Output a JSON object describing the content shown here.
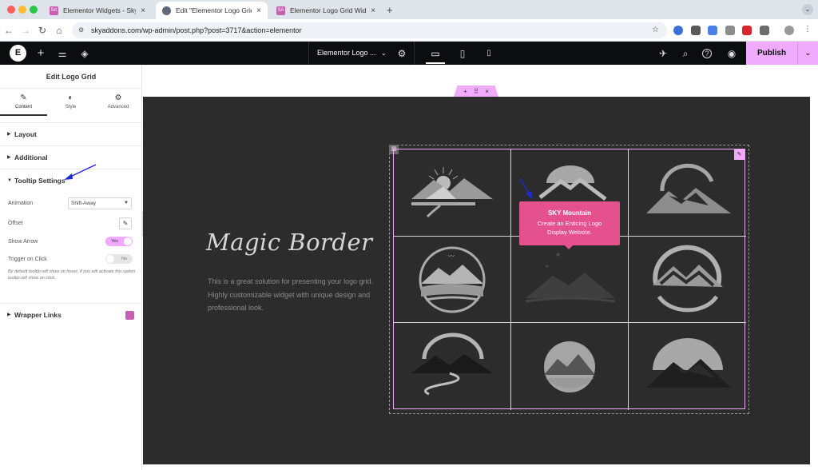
{
  "browser": {
    "tabs": [
      {
        "title": "Elementor Widgets - Sky Add",
        "active": false
      },
      {
        "title": "Edit \"Elementor Logo Grid W",
        "active": true
      },
      {
        "title": "Elementor Logo Grid Widget",
        "active": false
      }
    ],
    "new_tab": "+",
    "url": "skyaddons.com/wp-admin/post.php?post=3717&action=elementor"
  },
  "editor": {
    "logo": "E",
    "document_title": "Elementor Logo ...",
    "publish_label": "Publish"
  },
  "panel": {
    "title": "Edit Logo Grid",
    "tabs": [
      {
        "label": "Content",
        "icon": "pencil-icon"
      },
      {
        "label": "Style",
        "icon": "half-circle-icon"
      },
      {
        "label": "Advanced",
        "icon": "gear-icon"
      }
    ],
    "sections": {
      "layout": "Layout",
      "additional": "Additional",
      "tooltip": "Tooltip Settings",
      "wrapper": "Wrapper Links"
    },
    "controls": {
      "animation_label": "Animation",
      "animation_value": "Shift-Away",
      "offset_label": "Offset",
      "show_arrow_label": "Show Arrow",
      "show_arrow_state": "Yes",
      "trigger_label": "Trigger on Click",
      "trigger_state": "No",
      "hint": "By default tooltip will show on hover, if you will activate this option tooltip will show on click."
    }
  },
  "canvas": {
    "heading": "Magic Border",
    "description": "This is a great solution for presenting your logo grid. Highly customizable widget with unique design and professional look.",
    "tooltip": {
      "title": "SKY Mountain",
      "body": "Create an Enticing Logo Display Website."
    }
  },
  "colors": {
    "accent": "#f0abfc",
    "tooltip": "#e5508f",
    "canvas_bg": "#2d2c2c",
    "annotation_arrow": "#1d2bd6"
  }
}
